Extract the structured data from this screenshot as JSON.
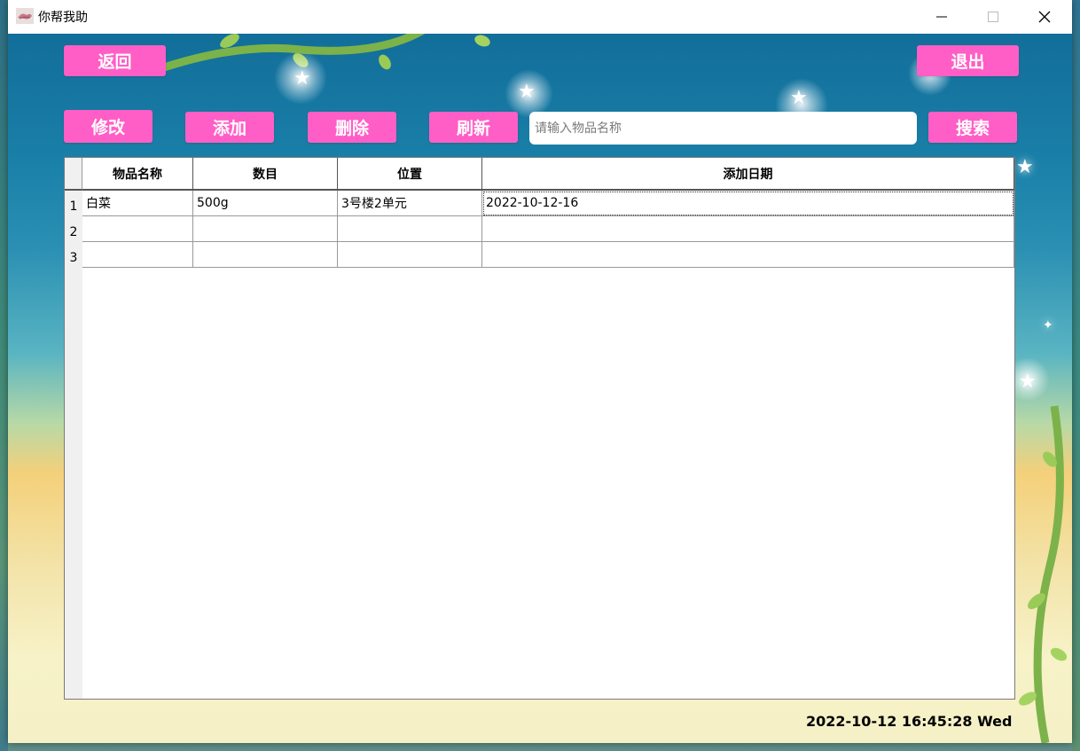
{
  "window": {
    "title": "你帮我助"
  },
  "toolbar": {
    "back_label": "返回",
    "exit_label": "退出",
    "edit_label": "修改",
    "add_label": "添加",
    "delete_label": "删除",
    "refresh_label": "刷新",
    "search_label": "搜索",
    "search_placeholder": "请输入物品名称",
    "search_value": ""
  },
  "table": {
    "columns": [
      "物品名称",
      "数目",
      "位置",
      "添加日期"
    ],
    "rows": [
      {
        "num": "1",
        "cells": [
          "白菜",
          "500g",
          "3号楼2单元",
          "2022-10-12-16"
        ]
      },
      {
        "num": "2",
        "cells": [
          "",
          "",
          "",
          ""
        ]
      },
      {
        "num": "3",
        "cells": [
          "",
          "",
          "",
          ""
        ]
      }
    ]
  },
  "status": {
    "clock": "2022-10-12 16:45:28 Wed"
  },
  "colors": {
    "button_bg": "#ff5ec6",
    "button_text": "#ffffff"
  }
}
